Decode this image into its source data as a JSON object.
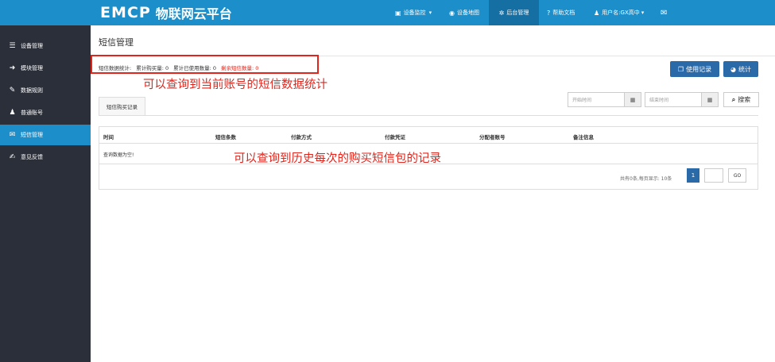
{
  "logo": {
    "mark": "EMCP",
    "text": "物联网云平台"
  },
  "topnav": [
    {
      "label": "设备监控",
      "icon": "monitor-icon",
      "glyph": "▣",
      "caret": "▾"
    },
    {
      "label": "设备地图",
      "icon": "globe-icon",
      "glyph": "◉"
    },
    {
      "label": "后台管理",
      "icon": "gears-icon",
      "glyph": "✲",
      "active": true
    },
    {
      "label": "帮助文档",
      "icon": "help-icon",
      "glyph": "?"
    },
    {
      "label": "用户名:GX高中",
      "icon": "user-icon",
      "glyph": "♟",
      "caret": "▾"
    },
    {
      "label": "",
      "icon": "mail-icon",
      "glyph": "✉"
    }
  ],
  "sidebar": {
    "items": [
      {
        "label": "设备管理",
        "icon": "list-icon",
        "glyph": "☰"
      },
      {
        "label": "模块管理",
        "icon": "sign-in-icon",
        "glyph": "➜"
      },
      {
        "label": "数据规则",
        "icon": "pencil-icon",
        "glyph": "✎"
      },
      {
        "label": "普通账号",
        "icon": "user-icon",
        "glyph": "♟"
      },
      {
        "label": "短信管理",
        "icon": "envelope-icon",
        "glyph": "✉",
        "active": true
      },
      {
        "label": "意见反馈",
        "icon": "edit-icon",
        "glyph": "✍"
      }
    ]
  },
  "page": {
    "title": "短信管理"
  },
  "stats": {
    "label": "短信数据统计:",
    "purchased": "累计购买量: 0",
    "used": "累计已使用数量: 0",
    "remaining": "剩余短信数量: 0",
    "colors": {
      "remaining": "#e0261c"
    }
  },
  "annotations": {
    "stats_note": "可以查询到当前账号的短信数据统计",
    "records_note": "可以查询到历史每次的购买短信包的记录",
    "color": "#e0261c"
  },
  "buttons": {
    "usage_records": "使用记录",
    "usage_records_icon": "copy-icon",
    "statistics": "统计",
    "statistics_icon": "pie-chart-icon",
    "search": "搜索",
    "search_icon": "search-icon"
  },
  "tabs": [
    {
      "label": "短信购买记录"
    }
  ],
  "filters": {
    "start_placeholder": "开始时间",
    "end_placeholder": "结束时间"
  },
  "table": {
    "columns": [
      "时间",
      "短信条数",
      "付款方式",
      "付款凭证",
      "分配者账号",
      "备注信息"
    ],
    "empty_text": "查询数据为空!"
  },
  "pager": {
    "summary": "共有0条,每页显示: 10条",
    "current_page": "1",
    "go_label": "GO"
  },
  "colors": {
    "brand": "#1c8ec9",
    "sidebar": "#2b2f3a",
    "button": "#2b6aa8"
  }
}
